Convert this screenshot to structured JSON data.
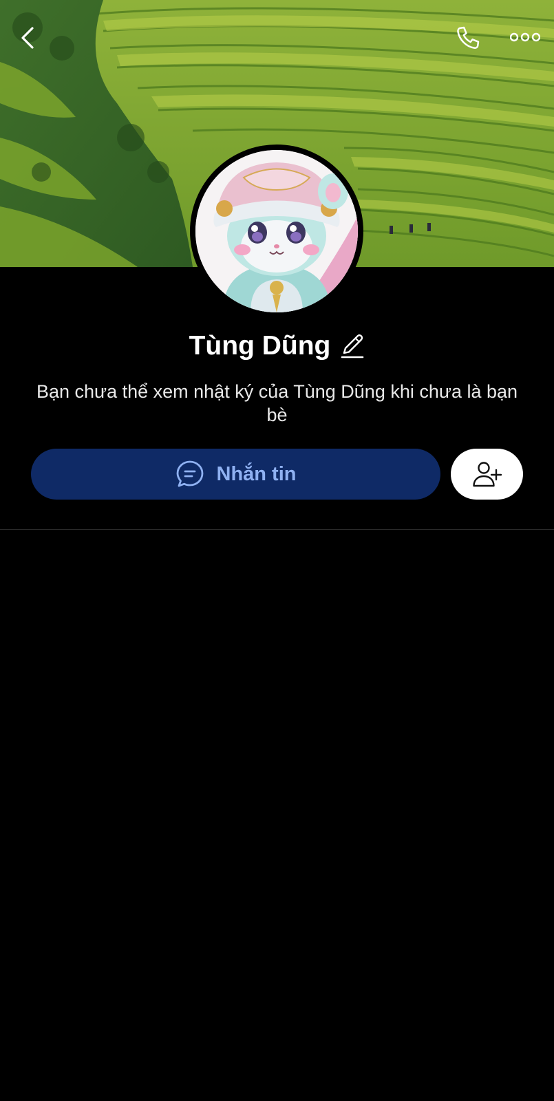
{
  "profile": {
    "name": "Tùng Dũng",
    "notice": "Bạn chưa thể xem nhật ký của Tùng Dũng khi chưa là bạn bè"
  },
  "actions": {
    "message_label": "Nhắn tin"
  },
  "icons": {
    "back": "chevron-left-icon",
    "call": "phone-icon",
    "more": "more-horizontal-icon",
    "edit": "pencil-icon",
    "chat": "chat-bubble-icon",
    "add_friend": "add-user-icon"
  },
  "colors": {
    "background": "#000000",
    "message_button_bg": "#0f2a66",
    "message_button_text": "#8fb1f2",
    "add_friend_bg": "#ffffff"
  }
}
